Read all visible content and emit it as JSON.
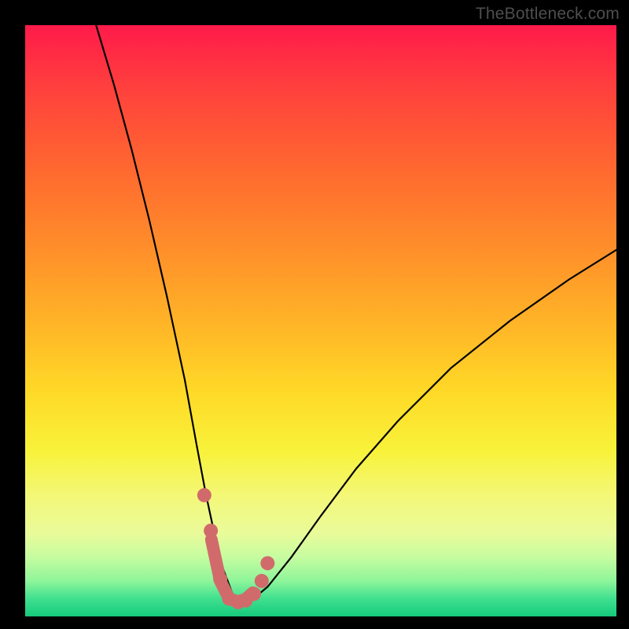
{
  "watermark": "TheBottleneck.com",
  "chart_data": {
    "type": "line",
    "title": "",
    "xlabel": "",
    "ylabel": "",
    "xlim": [
      0,
      100
    ],
    "ylim": [
      0,
      100
    ],
    "series": [
      {
        "name": "bottleneck-curve",
        "x": [
          12,
          15,
          18,
          21,
          24,
          27,
          29,
          30.5,
          32,
          33.5,
          35,
          36.5,
          38,
          41,
          45,
          50,
          56,
          63,
          72,
          82,
          92,
          100
        ],
        "values": [
          100,
          90,
          79,
          67,
          54,
          40,
          29,
          21,
          14,
          8,
          4,
          2,
          2.5,
          5,
          10,
          17,
          25,
          33,
          42,
          50,
          57,
          62
        ]
      }
    ],
    "markers": {
      "name": "highlight-dots",
      "color": "#d16b6b",
      "x": [
        30.3,
        31.4,
        33.0,
        34.5,
        36.0,
        37.3,
        38.7,
        40.0,
        41.0
      ],
      "values": [
        20.5,
        14.5,
        6.3,
        3.0,
        2.4,
        2.7,
        3.8,
        6.0,
        9.0
      ]
    },
    "thick_segment": {
      "name": "highlight-trough",
      "color": "#d16b6b",
      "x": [
        31.5,
        33.0,
        34.5,
        36.0,
        37.3,
        38.5
      ],
      "values": [
        13.0,
        6.0,
        3.0,
        2.5,
        2.9,
        4.0
      ]
    }
  }
}
